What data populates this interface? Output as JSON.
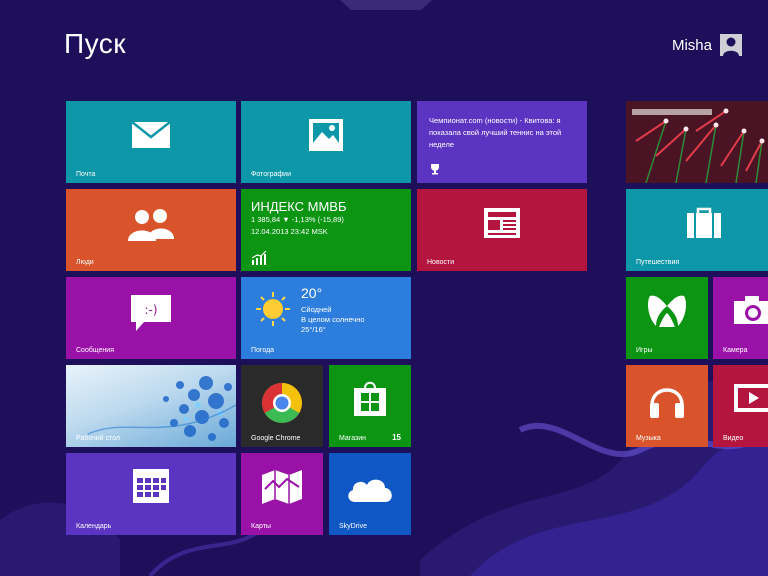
{
  "header": {
    "title": "Пуск",
    "user_name": "Misha"
  },
  "colors": {
    "background": "#1e0f5b",
    "teal": "#0e97a8",
    "orange": "#d9542b",
    "magenta": "#9a11a8",
    "purple": "#5b34c2",
    "green": "#0c9413",
    "crimson": "#b3153f",
    "blue": "#2c7ddc",
    "dark_tile": "#2a2a2a",
    "skydrive_blue": "#0f57c4"
  },
  "tiles": {
    "mail": {
      "label": "Почта",
      "icon": "envelope-icon"
    },
    "photos": {
      "label": "Фотографии",
      "icon": "photo-icon"
    },
    "news_live": {
      "text": "Чемпионат.com  (новости) - Квитова: я показала свой лучший теннис на этой неделе",
      "icon": "trophy-icon"
    },
    "people": {
      "label": "Люди",
      "icon": "people-icon"
    },
    "finance": {
      "title": "ИНДЕКС ММВБ",
      "quote": "1 385,84  ▼ -1,13% (-15,89)",
      "datetime": "12.04.2013 23:42 MSK",
      "icon": "chart-icon"
    },
    "news": {
      "label": "Новости",
      "icon": "newspaper-icon"
    },
    "messaging": {
      "label": "Сообщения",
      "icon": "chat-icon"
    },
    "weather": {
      "label": "Погода",
      "temp": "20°",
      "day": "Сйодней",
      "condition": "В целом солнечно",
      "range": "25°/16°",
      "icon": "sun-icon"
    },
    "desktop": {
      "label": "Рабочий стол"
    },
    "chrome": {
      "label": "Google Chrome",
      "icon": "chrome-icon"
    },
    "store": {
      "label": "Магазин",
      "badge": "15",
      "icon": "store-icon"
    },
    "calendar": {
      "label": "Календарь",
      "icon": "calendar-icon"
    },
    "maps": {
      "label": "Карты",
      "icon": "map-icon"
    },
    "skydrive": {
      "label": "SkyDrive",
      "icon": "cloud-icon"
    },
    "photo_live": {
      "label": ""
    },
    "travel": {
      "label": "Путешествия",
      "icon": "suitcase-icon"
    },
    "games": {
      "label": "Игры",
      "icon": "xbox-icon"
    },
    "camera": {
      "label": "Камера",
      "icon": "camera-icon"
    },
    "music": {
      "label": "Музыка",
      "icon": "headphones-icon"
    },
    "video": {
      "label": "Видео",
      "icon": "play-icon"
    }
  }
}
